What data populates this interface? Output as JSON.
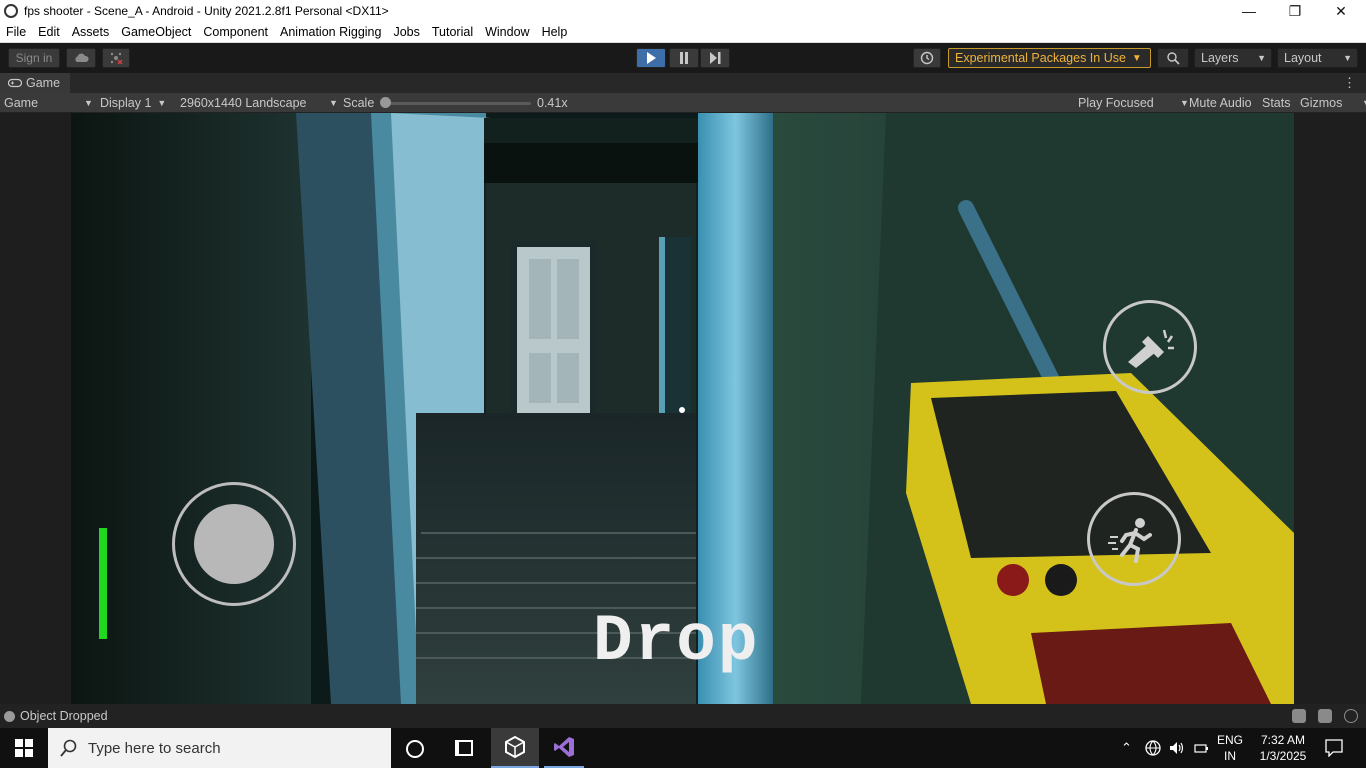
{
  "window": {
    "title": "fps shooter - Scene_A - Android - Unity 2021.2.8f1 Personal <DX11>"
  },
  "menu": [
    "File",
    "Edit",
    "Assets",
    "GameObject",
    "Component",
    "Animation Rigging",
    "Jobs",
    "Tutorial",
    "Window",
    "Help"
  ],
  "toolbar": {
    "sign_in": "Sign in",
    "experimental": "Experimental Packages In Use",
    "layers": "Layers",
    "layout": "Layout"
  },
  "game_tab": {
    "label": "Game"
  },
  "game_bar": {
    "view_mode": "Game",
    "display": "Display 1",
    "resolution": "2960x1440 Landscape",
    "scale_label": "Scale",
    "scale_value": "0.41x",
    "play_mode": "Play Focused",
    "mute": "Mute Audio",
    "stats": "Stats",
    "gizmos": "Gizmos"
  },
  "hud": {
    "drop_label": "Drop",
    "health_fraction": 1.0
  },
  "status": {
    "message": "Object Dropped"
  },
  "taskbar": {
    "search_placeholder": "Type here to search",
    "lang_top": "ENG",
    "lang_bottom": "IN",
    "time": "7:32 AM",
    "date": "1/3/2025"
  },
  "colors": {
    "play_active": "#3d6ea8",
    "experimental": "#f0b33a",
    "health_bar": "#1fd81f",
    "walkie_body": "#d4c21a"
  }
}
